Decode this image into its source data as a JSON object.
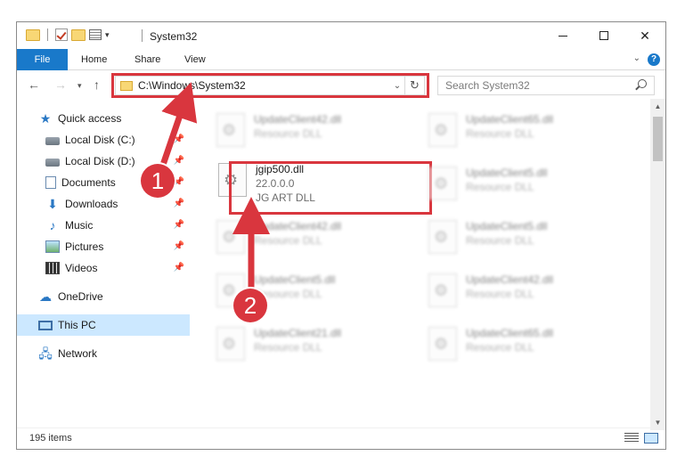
{
  "titlebar": {
    "title": "System32",
    "icons": [
      "folder-icon",
      "properties-check-icon",
      "folder-icon",
      "properties-icon",
      "qat-dropdown-icon"
    ],
    "window_buttons": [
      "minimize",
      "maximize",
      "close"
    ],
    "close_glyph": "✕"
  },
  "ribbon": {
    "tabs": [
      "File",
      "Home",
      "Share",
      "View"
    ],
    "expand_glyph": "⌄",
    "help_glyph": "?"
  },
  "nav": {
    "back_glyph": "←",
    "forward_glyph": "→",
    "recent_glyph": "▾",
    "up_glyph": "↑",
    "address_path": "C:\\Windows\\System32",
    "dropdown_glyph": "⌄",
    "refresh_glyph": "↻",
    "search_placeholder": "Search System32"
  },
  "sidebar": {
    "items": [
      {
        "label": "Quick access",
        "icon": "star-icon",
        "glyph": "★",
        "pinned": false
      },
      {
        "label": "Local Disk (C:)",
        "icon": "disk-icon",
        "pinned": true
      },
      {
        "label": "Local Disk (D:)",
        "icon": "disk-icon",
        "pinned": true
      },
      {
        "label": "Documents",
        "icon": "documents-icon",
        "pinned": true
      },
      {
        "label": "Downloads",
        "icon": "download-icon",
        "glyph": "⬇",
        "pinned": true
      },
      {
        "label": "Music",
        "icon": "music-icon",
        "glyph": "♪",
        "pinned": true
      },
      {
        "label": "Pictures",
        "icon": "pictures-icon",
        "pinned": true
      },
      {
        "label": "Videos",
        "icon": "videos-icon",
        "pinned": true
      },
      {
        "label": "OneDrive",
        "icon": "cloud-icon",
        "glyph": "☁",
        "pinned": false
      },
      {
        "label": "This PC",
        "icon": "pc-icon",
        "pinned": false,
        "selected": true
      },
      {
        "label": "Network",
        "icon": "network-icon",
        "glyph": "🖧",
        "pinned": false
      }
    ],
    "pin_glyph": "📌"
  },
  "files": {
    "left_column": [
      {
        "name": "UpdateClient42.dll",
        "type": "Resource DLL"
      },
      {
        "name": "UpdateClient42.dll",
        "type": "Resource DLL"
      },
      {
        "name": "UpdateClient5.dll",
        "type": "Resource DLL"
      },
      {
        "name": "UpdateClient21.dll",
        "type": "Resource DLL"
      }
    ],
    "right_column": [
      {
        "name": "UpdateClient65.dll",
        "type": "Resource DLL"
      },
      {
        "name": "UpdateClient5.dll",
        "type": "Resource DLL"
      },
      {
        "name": "UpdateClient5.dll",
        "type": "Resource DLL"
      },
      {
        "name": "UpdateClient42.dll",
        "type": "Resource DLL"
      },
      {
        "name": "UpdateClient65.dll",
        "type": "Resource DLL"
      }
    ],
    "focus": {
      "name": "jgip500.dll",
      "version": "22.0.0.0",
      "description": "JG ART DLL"
    }
  },
  "status": {
    "item_count": "195 items"
  },
  "callouts": {
    "one": "1",
    "two": "2",
    "accent_color": "#d9363e"
  },
  "colors": {
    "accent": "#1979ca",
    "selection": "#cce8ff"
  }
}
